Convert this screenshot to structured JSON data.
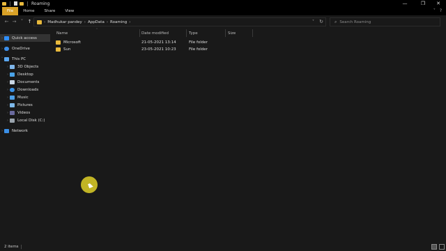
{
  "window": {
    "title": "Roaming",
    "minimize_glyph": "—",
    "maximize_glyph": "❐",
    "close_glyph": "✕"
  },
  "ribbon": {
    "tabs": [
      "File",
      "Home",
      "Share",
      "View"
    ],
    "collapse_glyph": "˅",
    "help_glyph": "?"
  },
  "navigation": {
    "back_glyph": "←",
    "forward_glyph": "→",
    "recent_glyph": "˅",
    "up_glyph": "↑"
  },
  "address": {
    "breadcrumbs": [
      "Madhukar pandey",
      "AppData",
      "Roaming"
    ],
    "separator": "›",
    "dropdown_glyph": "˅",
    "refresh_glyph": "↻"
  },
  "search": {
    "placeholder": "Search Roaming",
    "icon": "search-icon"
  },
  "sidebar": {
    "items": [
      {
        "label": "Quick access",
        "icon": "star-icon",
        "active": true
      },
      {
        "label": "OneDrive",
        "icon": "cloud-icon"
      },
      {
        "label": "This PC",
        "icon": "computer-icon"
      },
      {
        "label": "3D Objects",
        "icon": "cube-icon"
      },
      {
        "label": "Desktop",
        "icon": "desktop-icon"
      },
      {
        "label": "Documents",
        "icon": "documents-icon"
      },
      {
        "label": "Downloads",
        "icon": "download-icon"
      },
      {
        "label": "Music",
        "icon": "music-icon"
      },
      {
        "label": "Pictures",
        "icon": "pictures-icon"
      },
      {
        "label": "Videos",
        "icon": "videos-icon"
      },
      {
        "label": "Local Disk (C:)",
        "icon": "disk-icon"
      },
      {
        "label": "Network",
        "icon": "network-icon"
      }
    ]
  },
  "file_list": {
    "columns": [
      "Name",
      "Date modified",
      "Type",
      "Size"
    ],
    "rows": [
      {
        "name": "Microsoft",
        "date": "21-05-2021 13:14",
        "type": "File folder",
        "size": ""
      },
      {
        "name": "Sun",
        "date": "23-05-2021 10:23",
        "type": "File folder",
        "size": ""
      }
    ]
  },
  "status": {
    "item_count": "2 items",
    "divider": "|"
  },
  "colors": {
    "background": "#191919",
    "titlebar": "#000000",
    "file_tab": "#d9a126",
    "folder": "#e8b93c",
    "cursor_highlight": "#e6d728"
  }
}
